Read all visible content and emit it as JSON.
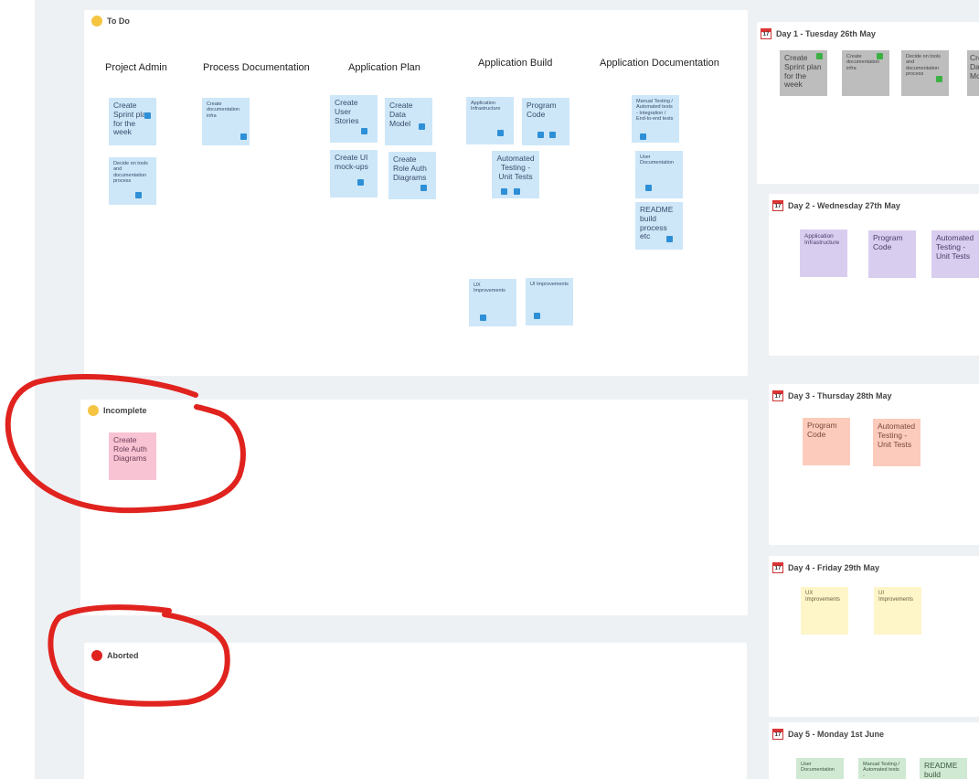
{
  "todo": {
    "title": "To Do",
    "columns": [
      "Project Admin",
      "Process Documentation",
      "Application Plan",
      "Application Build",
      "Application Documentation"
    ],
    "stickies": {
      "sprint_plan": "Create Sprint plan for the week",
      "decide_tools": "Decide on tools and documentation process",
      "doc_infra": "Create documentation infra",
      "user_stories": "Create User Stories",
      "data_model": "Create Data Model",
      "ui_mockups": "Create UI mock-ups",
      "role_auth": "Create Role Auth Diagrams",
      "app_infra": "Application Infrastructure",
      "program_code": "Program Code",
      "auto_testing": "Automated Testing - Unit Tests",
      "ux_impr": "UX Improvements",
      "ui_impr": "UI Improvements",
      "manual_testing": "Manual Testing / Automated tests - Integration / End-to-end tests",
      "user_docs": "User Documentation",
      "readme": "README build process etc"
    }
  },
  "incomplete": {
    "title": "Incomplete",
    "sticky": "Create Role Auth Diagrams"
  },
  "aborted": {
    "title": "Aborted"
  },
  "days": [
    {
      "title": "Day 1 - Tuesday 26th May",
      "stickies": [
        "Create Sprint plan for the week",
        "Create documentation infra",
        "Decide on tools and documentation process",
        "Create Data Model"
      ]
    },
    {
      "title": "Day 2 - Wednesday 27th May",
      "stickies": [
        "Application Infrastructure",
        "Program Code",
        "Automated Testing - Unit Tests"
      ]
    },
    {
      "title": "Day 3 - Thursday 28th May",
      "stickies": [
        "Program Code",
        "Automated Testing - Unit Tests"
      ]
    },
    {
      "title": "Day 4 - Friday 29th May",
      "stickies": [
        "UX Improvements",
        "UI Improvements"
      ]
    },
    {
      "title": "Day 5 - Monday 1st June",
      "stickies": [
        "User Documentation",
        "Manual Testing / Automated tests -",
        "README build"
      ]
    }
  ],
  "calendar_icon_text": "17",
  "colors": {
    "annotation": "#e0231e",
    "todo_sticky": "#cde7f8",
    "done_sticky": "#bdbdbd",
    "incomplete_sticky": "#f8c3d3",
    "day2_sticky": "#d9cdef",
    "day3_sticky": "#fccbbb",
    "day4_sticky": "#fef5c8",
    "day5_sticky": "#cfe9d2"
  }
}
